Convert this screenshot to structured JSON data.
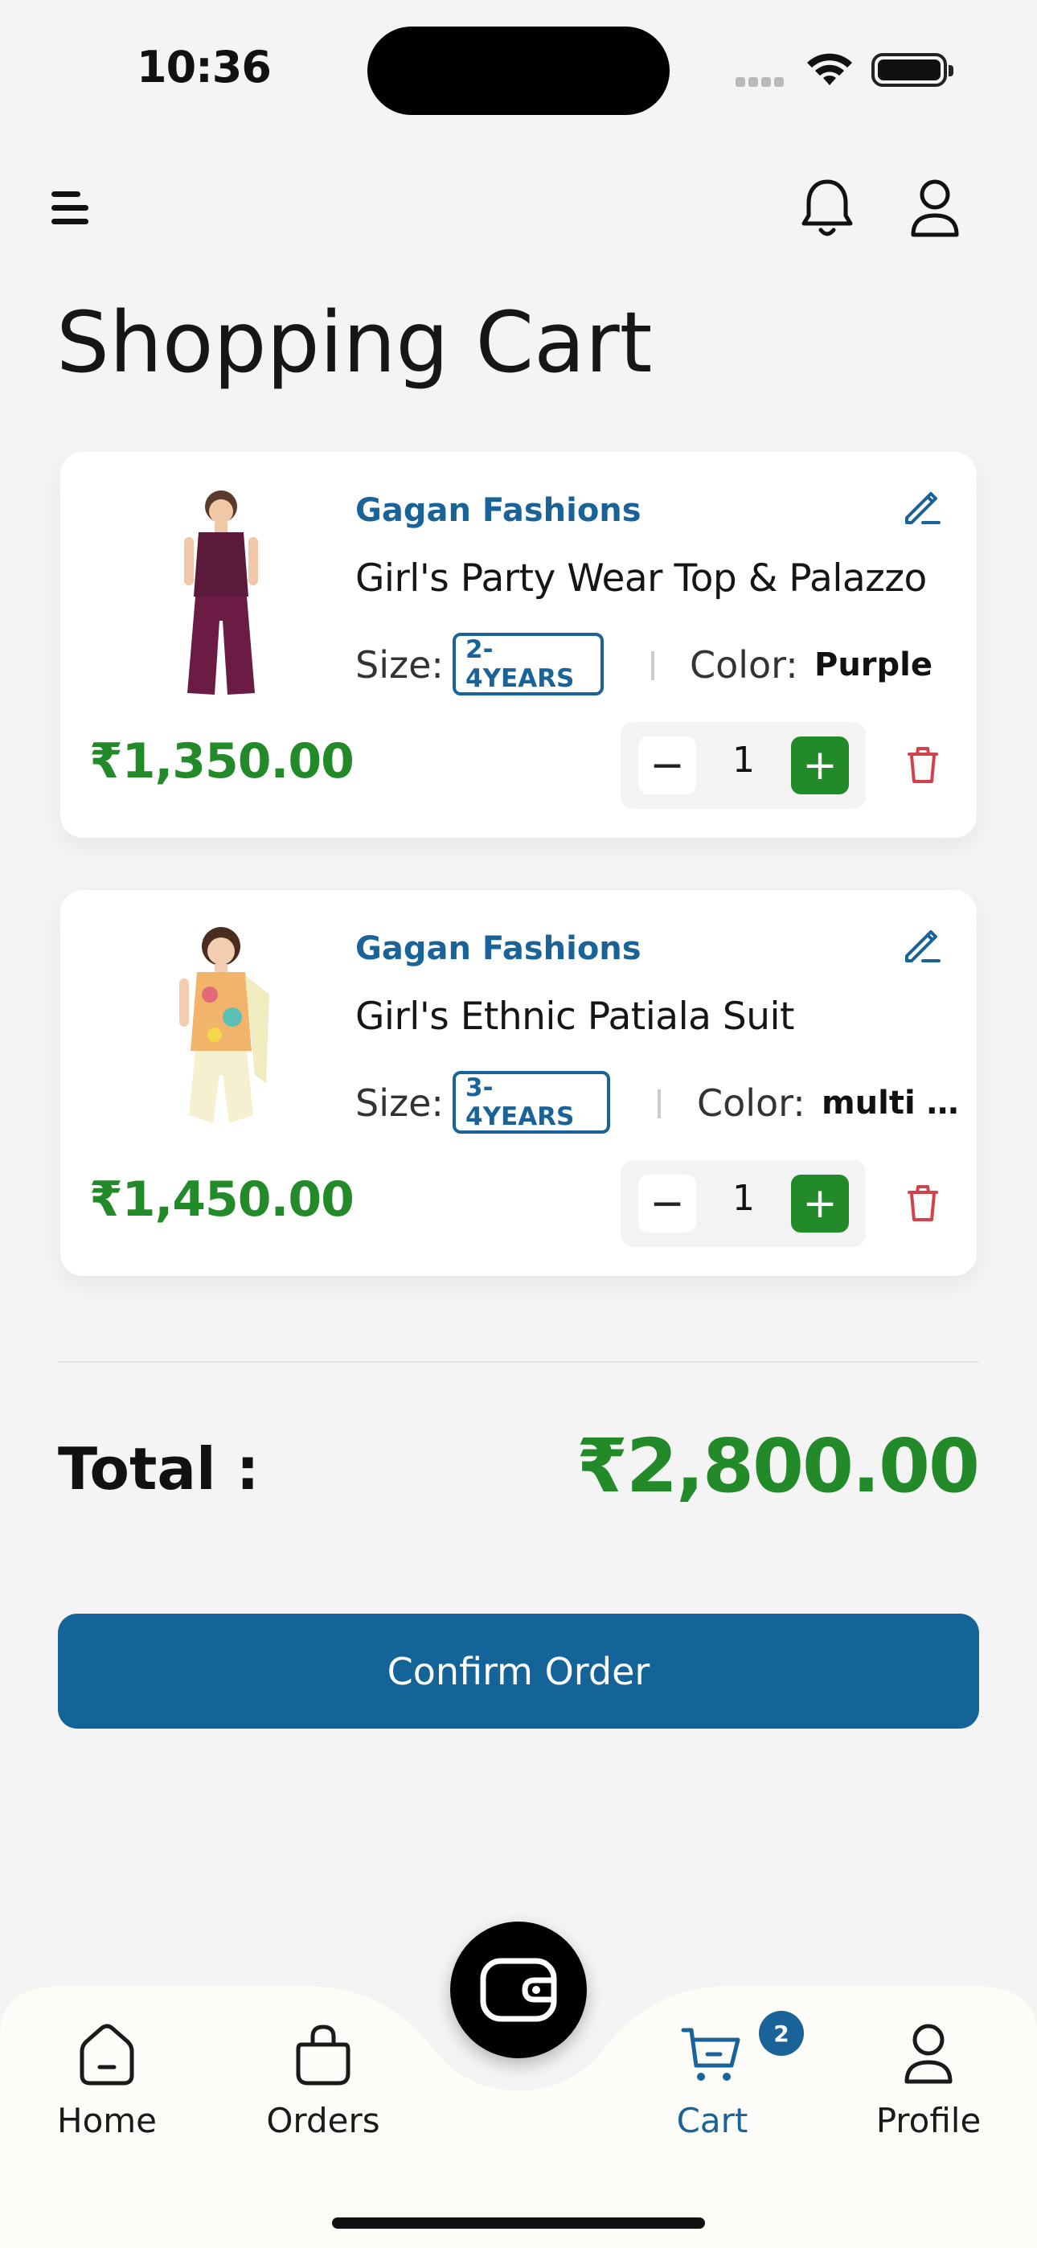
{
  "status_bar": {
    "time": "10:36"
  },
  "header": {
    "title": "Shopping Cart"
  },
  "cart": {
    "items": [
      {
        "brand": "Gagan Fashions",
        "name": "Girl's Party Wear Top & Palazzo",
        "size_label": "Size:",
        "size": "2-4YEARS",
        "color_label": "Color:",
        "color": "Purple",
        "price": "₹1,350.00",
        "quantity": "1"
      },
      {
        "brand": "Gagan Fashions",
        "name": "Girl's Ethnic Patiala Suit",
        "size_label": "Size:",
        "size": "3-4YEARS",
        "color_label": "Color:",
        "color": "multi c...",
        "price": "₹1,450.00",
        "quantity": "1"
      }
    ]
  },
  "summary": {
    "total_label": "Total :",
    "total_value": "₹2,800.00",
    "confirm_label": "Confirm Order"
  },
  "tabbar": {
    "tabs": [
      {
        "label": "Home",
        "icon": "home-icon"
      },
      {
        "label": "Orders",
        "icon": "bag-icon"
      },
      {
        "label": "Cart",
        "icon": "cart-icon",
        "badge": "2",
        "active": true
      },
      {
        "label": "Profile",
        "icon": "profile-icon"
      }
    ],
    "fab_icon": "wallet-icon"
  },
  "colors": {
    "primary": "#146399",
    "price_green": "#238a2a",
    "delete_red": "#d0434b",
    "background": "#f4f4f4"
  }
}
